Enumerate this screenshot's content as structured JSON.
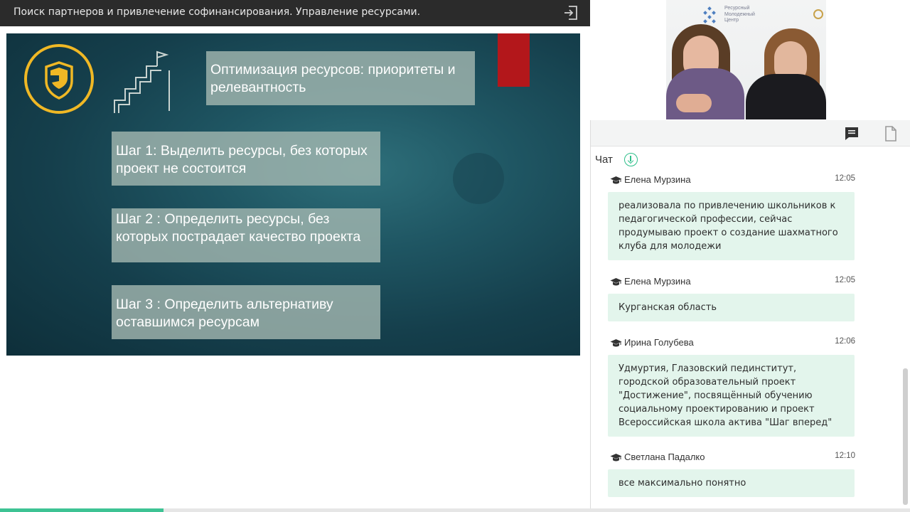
{
  "header": {
    "title": "Поиск партнеров и привлечение софинансирования. Управление ресурсами.",
    "exit_icon": "exit-icon"
  },
  "slide": {
    "heading": "Оптимизация ресурсов: приоритеты и релевантность",
    "steps": [
      {
        "text": "Шаг 1: Выделить ресурсы, без которых проект не состоится"
      },
      {
        "text": "Шаг 2 : Определить ресурсы, без которых пострадает качество проекта"
      },
      {
        "text": "Шаг 3 : Определить альтернативу оставшимся ресурсам"
      }
    ],
    "logo_icon": "shield-logo-icon",
    "stairs_icon": "stairs-flag-icon",
    "colors": {
      "accent_red": "#b3171b",
      "logo_gold": "#f0b825"
    }
  },
  "video": {
    "banner": {
      "line1": "Ресурсный",
      "line2": "Молодежный",
      "line3": "Центр"
    }
  },
  "panel": {
    "tabs": [
      {
        "icon": "chat-icon"
      },
      {
        "icon": "file-icon"
      }
    ],
    "chat_label": "Чат",
    "download_icon": "download-icon",
    "messages": [
      {
        "author": "Елена Мурзина",
        "time": "12:05",
        "text": "реализовала по привлечению школьников к педагогической профессии, сейчас продумываю проект о создание шахматного клуба для молодежи"
      },
      {
        "author": "Елена Мурзина",
        "time": "12:05",
        "text": "Курганская область"
      },
      {
        "author": "Ирина Голубева",
        "time": "12:06",
        "text": "Удмуртия, Глазовский пединститут, городской образовательный проект \"Достижение\", посвящённый обучению социальному проектированию и проект Всероссийская школа актива \"Шаг вперед\""
      },
      {
        "author": "Светлана Падалко",
        "time": "12:10",
        "text": "все максимально понятно"
      }
    ],
    "colors": {
      "bubble": "#e3f5ec",
      "accent_green": "#2ebf8a"
    }
  },
  "playback": {
    "progress": 0.18
  }
}
